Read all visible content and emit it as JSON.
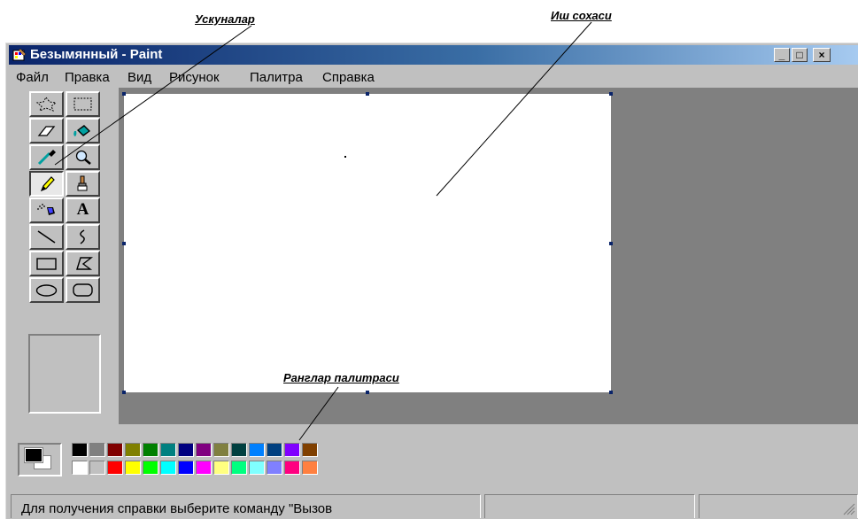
{
  "annotations": {
    "tools_label": "Ускуналар",
    "work_area_label": "Иш сохаси",
    "palette_label": "Ранглар палитраси"
  },
  "window": {
    "title": "Безымянный - Paint",
    "controls": {
      "minimize": "_",
      "maximize": "□",
      "close": "×"
    }
  },
  "menu": {
    "items": [
      "Файл",
      "Правка",
      "Вид",
      "Рисунок",
      "Палитра",
      "Справка"
    ]
  },
  "toolbox": {
    "tools": [
      {
        "icon": "free-select-icon"
      },
      {
        "icon": "rect-select-icon"
      },
      {
        "icon": "eraser-icon"
      },
      {
        "icon": "fill-icon"
      },
      {
        "icon": "color-picker-icon"
      },
      {
        "icon": "magnifier-icon"
      },
      {
        "icon": "pencil-icon",
        "pressed": true
      },
      {
        "icon": "brush-icon"
      },
      {
        "icon": "airbrush-icon"
      },
      {
        "icon": "text-icon",
        "label": "A"
      },
      {
        "icon": "line-icon"
      },
      {
        "icon": "curve-icon"
      },
      {
        "icon": "rectangle-icon"
      },
      {
        "icon": "polygon-icon"
      },
      {
        "icon": "ellipse-icon"
      },
      {
        "icon": "rounded-rectangle-icon"
      }
    ]
  },
  "palette": {
    "foreground": "#000000",
    "background": "#ffffff",
    "top_row": [
      "#000000",
      "#808080",
      "#800000",
      "#808000",
      "#008000",
      "#008080",
      "#000080",
      "#800080",
      "#808040",
      "#004040",
      "#0080ff",
      "#004080",
      "#8000ff",
      "#804000"
    ],
    "bottom_row": [
      "#ffffff",
      "#c0c0c0",
      "#ff0000",
      "#ffff00",
      "#00ff00",
      "#00ffff",
      "#0000ff",
      "#ff00ff",
      "#ffff80",
      "#00ff80",
      "#80ffff",
      "#8080ff",
      "#ff0080",
      "#ff8040"
    ]
  },
  "status": {
    "text": "Для получения справки выберите команду \"Вызов"
  }
}
